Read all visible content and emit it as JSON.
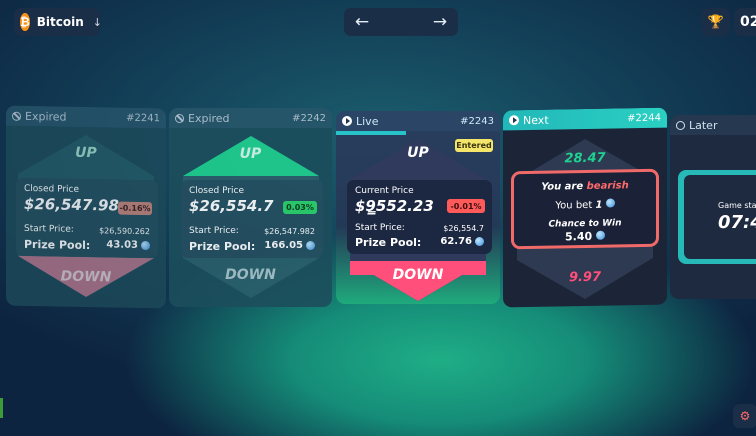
{
  "header": {
    "coin": {
      "symbol": "₿",
      "name": "Bitcoin"
    },
    "nav": {
      "prev_icon": "arrow-left-icon",
      "next_icon": "arrow-right-icon"
    },
    "trophy_icon": "trophy-icon",
    "timer_text": "02"
  },
  "cards": [
    {
      "status": "Expired",
      "epoch": "#2241",
      "up": "UP",
      "down": "DOWN",
      "price_label": "Closed Price",
      "price": "$26,547.98",
      "change": "-0.16%",
      "start_label": "Start Price:",
      "start_value": "$26,590.262",
      "pool_label": "Prize Pool:",
      "pool_value": "43.03"
    },
    {
      "status": "Expired",
      "epoch": "#2242",
      "up": "UP",
      "down": "DOWN",
      "price_label": "Closed Price",
      "price": "$26,554.7",
      "change": "0.03%",
      "start_label": "Start Price:",
      "start_value": "$26,547.982",
      "pool_label": "Prize Pool:",
      "pool_value": "166.05"
    },
    {
      "status": "Live",
      "epoch": "#2243",
      "entered": "Entered",
      "up": "UP",
      "down": "DOWN",
      "price_label": "Current Price",
      "price": "$9̳̲552.23",
      "change": "-0.01%",
      "start_label": "Start Price:",
      "start_value": "$26,554.7",
      "pool_label": "Prize Pool:",
      "pool_value": "62.76"
    },
    {
      "status": "Next",
      "epoch": "#2244",
      "top_value": "28.47",
      "bottom_value": "9.97",
      "bearish_prefix": "You are",
      "bearish_word": "bearish",
      "bet_label": "You bet",
      "bet_value": "1",
      "chance_label": "Chance to Win",
      "chance_value": "5.40"
    },
    {
      "status": "Later",
      "game_start_label": "Game start",
      "game_start_value": "07:4"
    }
  ],
  "colors": {
    "up_green": "#1fd18f",
    "down_pink": "#ff4f7a",
    "live_accent": "#26c4c8",
    "badge_red": "#ff5a5a",
    "badge_green": "#2bd46a",
    "entered_yellow": "#f4e66a"
  }
}
